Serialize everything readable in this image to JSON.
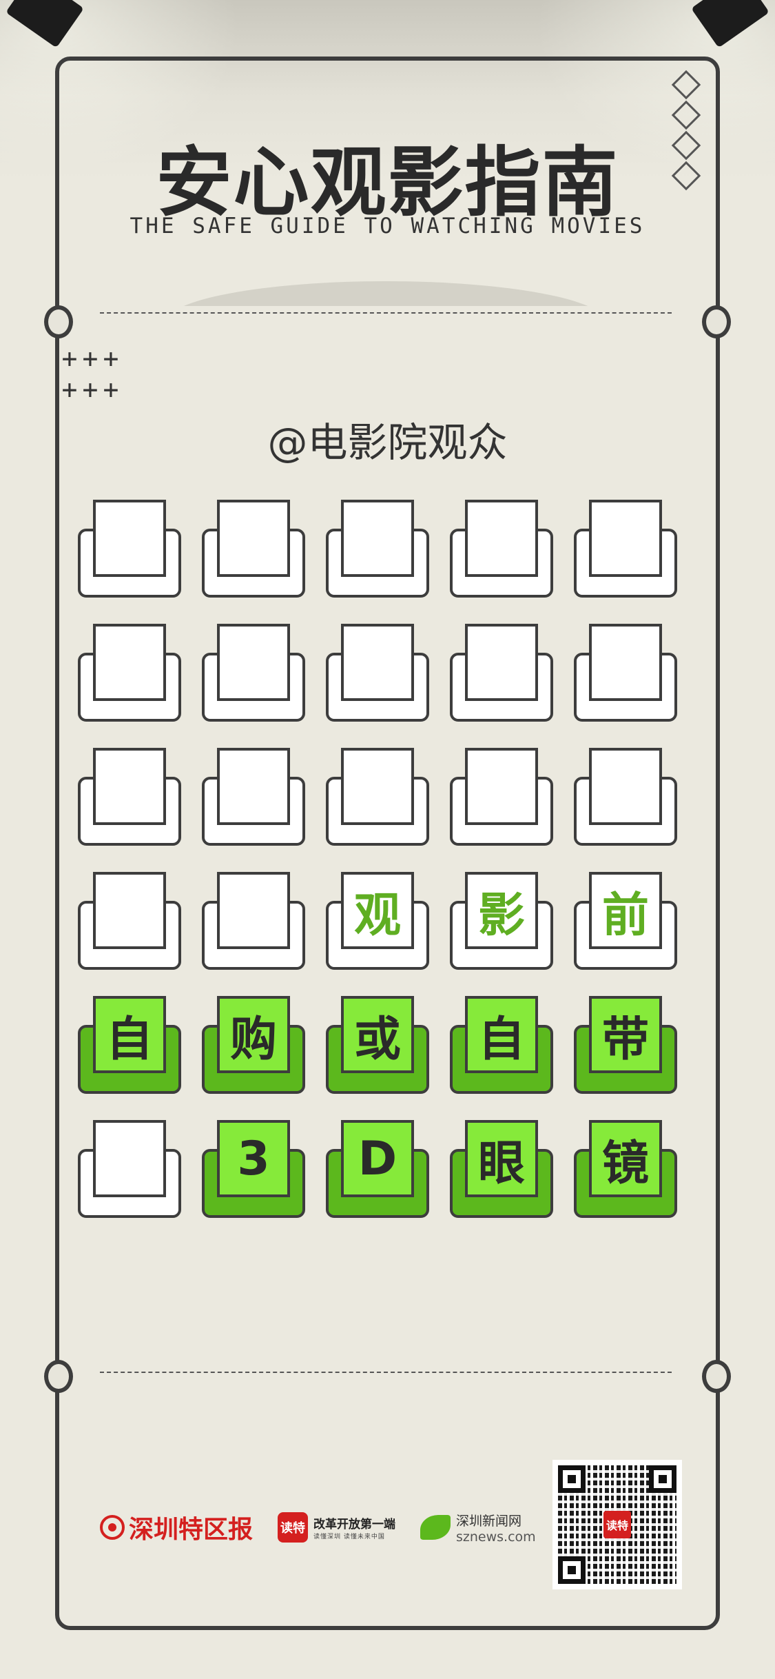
{
  "header": {
    "title": "安心观影指南",
    "subtitle": "THE SAFE GUIDE TO WATCHING MOVIES"
  },
  "audience": "@电影院观众",
  "grid": {
    "rows": [
      [
        {
          "char": "",
          "state": "empty"
        },
        {
          "char": "",
          "state": "empty"
        },
        {
          "char": "",
          "state": "empty"
        },
        {
          "char": "",
          "state": "empty"
        },
        {
          "char": "",
          "state": "empty"
        }
      ],
      [
        {
          "char": "",
          "state": "empty"
        },
        {
          "char": "",
          "state": "empty"
        },
        {
          "char": "",
          "state": "empty"
        },
        {
          "char": "",
          "state": "empty"
        },
        {
          "char": "",
          "state": "empty"
        }
      ],
      [
        {
          "char": "",
          "state": "empty"
        },
        {
          "char": "",
          "state": "empty"
        },
        {
          "char": "",
          "state": "empty"
        },
        {
          "char": "",
          "state": "empty"
        },
        {
          "char": "",
          "state": "empty"
        }
      ],
      [
        {
          "char": "",
          "state": "empty"
        },
        {
          "char": "",
          "state": "empty"
        },
        {
          "char": "观",
          "state": "partial"
        },
        {
          "char": "影",
          "state": "partial"
        },
        {
          "char": "前",
          "state": "partial"
        }
      ],
      [
        {
          "char": "自",
          "state": "filled"
        },
        {
          "char": "购",
          "state": "filled"
        },
        {
          "char": "或",
          "state": "filled"
        },
        {
          "char": "自",
          "state": "filled"
        },
        {
          "char": "带",
          "state": "filled"
        }
      ],
      [
        {
          "char": "",
          "state": "empty"
        },
        {
          "char": "3",
          "state": "filled"
        },
        {
          "char": "D",
          "state": "filled"
        },
        {
          "char": "眼",
          "state": "filled"
        },
        {
          "char": "镜",
          "state": "filled"
        }
      ]
    ]
  },
  "footer": {
    "logo_szsb": "深圳特区报",
    "logo_dute_box": "读特",
    "logo_dute_line1": "改革开放第一端",
    "logo_dute_line2": "读懂深圳 读懂未来中国",
    "logo_sznews_cn": "深圳新闻网",
    "logo_sznews_en": "sznews.com",
    "qr_center": "读特"
  },
  "colors": {
    "background": "#ebe9df",
    "outline": "#3d3d3d",
    "tile_green_dark": "#5cb81d",
    "tile_green_light": "#86ea3a",
    "brand_red": "#d4201f"
  }
}
